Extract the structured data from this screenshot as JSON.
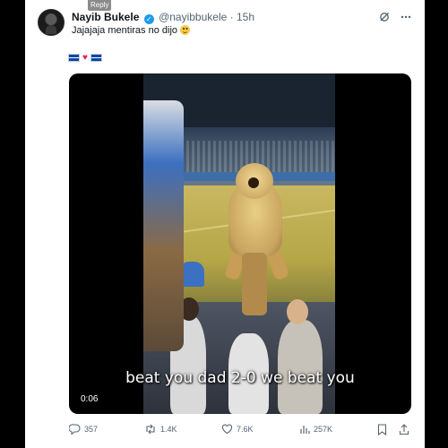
{
  "tooltip": {
    "label": "Reply"
  },
  "post": {
    "display_name": "Nayib Bukele",
    "handle": "@nayibbukele",
    "separator": "·",
    "time": "15h",
    "text": "Jajajaja mentiras no dijo",
    "emoji": "slightly-smiling-face",
    "flags": [
      "el-salvador-flag",
      "red-heart",
      "el-salvador-flag"
    ]
  },
  "media": {
    "caption": "beat you dad 2-0 we beat you",
    "duration": "0:06"
  },
  "actions": {
    "replies": "357",
    "reposts": "1.4K",
    "likes": "7.6K",
    "views": "257K"
  },
  "colors": {
    "verified": "#1d9bf0",
    "muted_text": "#536471",
    "primary_text": "#0f1419",
    "flag_blue": "#0047ab"
  }
}
